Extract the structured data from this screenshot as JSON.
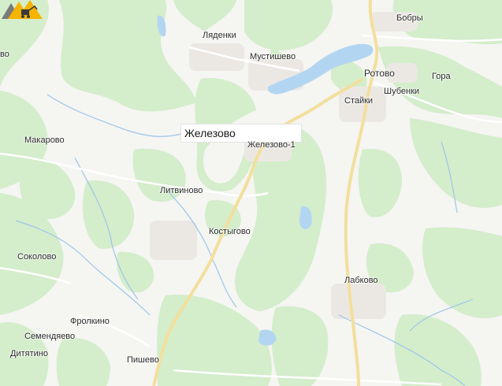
{
  "map": {
    "featured_place": {
      "name": "Железово",
      "icon": "construction-equipment-icon"
    },
    "places": [
      {
        "id": "bobry",
        "name": "Бобры"
      },
      {
        "id": "lyadenki",
        "name": "Ляденки"
      },
      {
        "id": "mustishevo",
        "name": "Мустишево"
      },
      {
        "id": "rotovo",
        "name": "Ротово"
      },
      {
        "id": "gora",
        "name": "Гора"
      },
      {
        "id": "shubenki",
        "name": "Шубенки"
      },
      {
        "id": "staiki",
        "name": "Стайки"
      },
      {
        "id": "makarovo",
        "name": "Макарово"
      },
      {
        "id": "zhelezovo1",
        "name": "Железово-1"
      },
      {
        "id": "litvinovo",
        "name": "Литвиново"
      },
      {
        "id": "kostygovo",
        "name": "Костыгово"
      },
      {
        "id": "sokolovo",
        "name": "Соколово"
      },
      {
        "id": "labkovo",
        "name": "Лабково"
      },
      {
        "id": "frolkino",
        "name": "Фролкино"
      },
      {
        "id": "semendyaevo",
        "name": "Семендяево"
      },
      {
        "id": "dityatino",
        "name": "Дитятино"
      },
      {
        "id": "pishevo",
        "name": "Пишево"
      },
      {
        "id": "edge_left",
        "name": "во"
      }
    ],
    "colors": {
      "background": "#f5f5f2",
      "forest": "#d4edcb",
      "water": "#b2d6f2",
      "road_major": "#f3df9c",
      "road_minor": "#ffffff",
      "stream": "#9cc6ea",
      "settlement": "#ebe8e4"
    }
  }
}
